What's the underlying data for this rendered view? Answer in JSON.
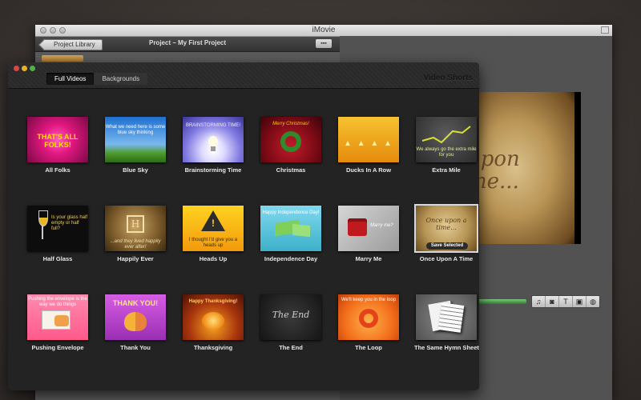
{
  "imovie": {
    "window_title": "iMovie",
    "back_button": "Project Library",
    "project_title": "Project – My First Project",
    "viewer_text": "upon\nme...",
    "controls": {
      "music": "♫",
      "photo": "◙",
      "title": "T",
      "transitions": "▣",
      "map": "◍"
    }
  },
  "panel": {
    "tabs": [
      "Full Videos",
      "Backgrounds"
    ],
    "active_tab": "Full Videos",
    "heading": "Video Shorts",
    "save_selected": "Save Selected",
    "items": [
      {
        "label": "All Folks",
        "caption": "THAT'S ALL FOLKS!"
      },
      {
        "label": "Blue Sky",
        "caption": "What we need here is some blue sky thinking"
      },
      {
        "label": "Brainstorming Time",
        "caption": "BRAINSTORMING TIME!"
      },
      {
        "label": "Christmas",
        "caption": "Merry Christmas!"
      },
      {
        "label": "Ducks In A Row",
        "caption": ""
      },
      {
        "label": "Extra Mile",
        "caption": "We always go the extra mile for you"
      },
      {
        "label": "Half Glass",
        "caption": "Is your glass half empty or half full?"
      },
      {
        "label": "Happily Ever",
        "caption": "...and they lived happily ever after!"
      },
      {
        "label": "Heads Up",
        "caption": "I thought I'd give you a heads up"
      },
      {
        "label": "Independence Day",
        "caption": "Happy Independence Day!"
      },
      {
        "label": "Marry Me",
        "caption": "Marry me?"
      },
      {
        "label": "Once Upon A Time",
        "caption": "Once upon a time..."
      },
      {
        "label": "Pushing Envelope",
        "caption": "Pushing the envelope is the way we do things"
      },
      {
        "label": "Thank You",
        "caption": "THANK YOU!"
      },
      {
        "label": "Thanksgiving",
        "caption": "Happy Thanksgiving!"
      },
      {
        "label": "The End",
        "caption": "The End"
      },
      {
        "label": "The Loop",
        "caption": "We'll keep you in the loop"
      },
      {
        "label": "The Same Hymn Sheet",
        "caption": ""
      }
    ]
  }
}
